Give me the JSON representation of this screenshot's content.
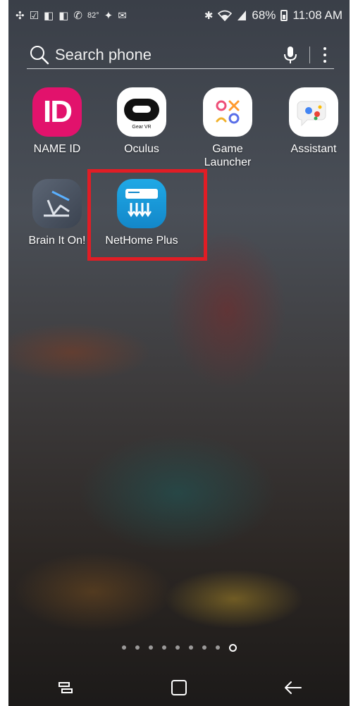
{
  "status_bar": {
    "battery_text": "68%",
    "time": "11:08 AM",
    "temperature": "82°",
    "left_icons": [
      "sync-icon",
      "check-box-icon",
      "flipboard-icon",
      "flipboard-icon",
      "wifi-call-icon",
      "temperature-icon",
      "twitter-icon",
      "mail-icon"
    ],
    "right_icons": [
      "bluetooth-icon",
      "wifi-icon",
      "signal-icon",
      "battery-icon"
    ]
  },
  "search": {
    "placeholder": "Search phone"
  },
  "apps": [
    {
      "label": "NAME ID",
      "icon": "name-id-icon",
      "glyph": "ID",
      "color": "#e2126c"
    },
    {
      "label": "Oculus",
      "icon": "oculus-icon",
      "glyph": "Gear VR",
      "color": "#ffffff"
    },
    {
      "label": "Game\nLauncher",
      "icon": "game-launcher-icon",
      "color": "#ffffff"
    },
    {
      "label": "Assistant",
      "icon": "assistant-icon",
      "color": "#ffffff"
    },
    {
      "label": "Brain It On!",
      "icon": "brain-it-on-icon",
      "color": "#4a5360"
    },
    {
      "label": "NetHome Plus",
      "icon": "nethome-plus-icon",
      "color": "#1fa9e6"
    }
  ],
  "highlight": {
    "color": "#e11d25",
    "target": "NetHome Plus"
  },
  "pages": {
    "count": 9
  }
}
